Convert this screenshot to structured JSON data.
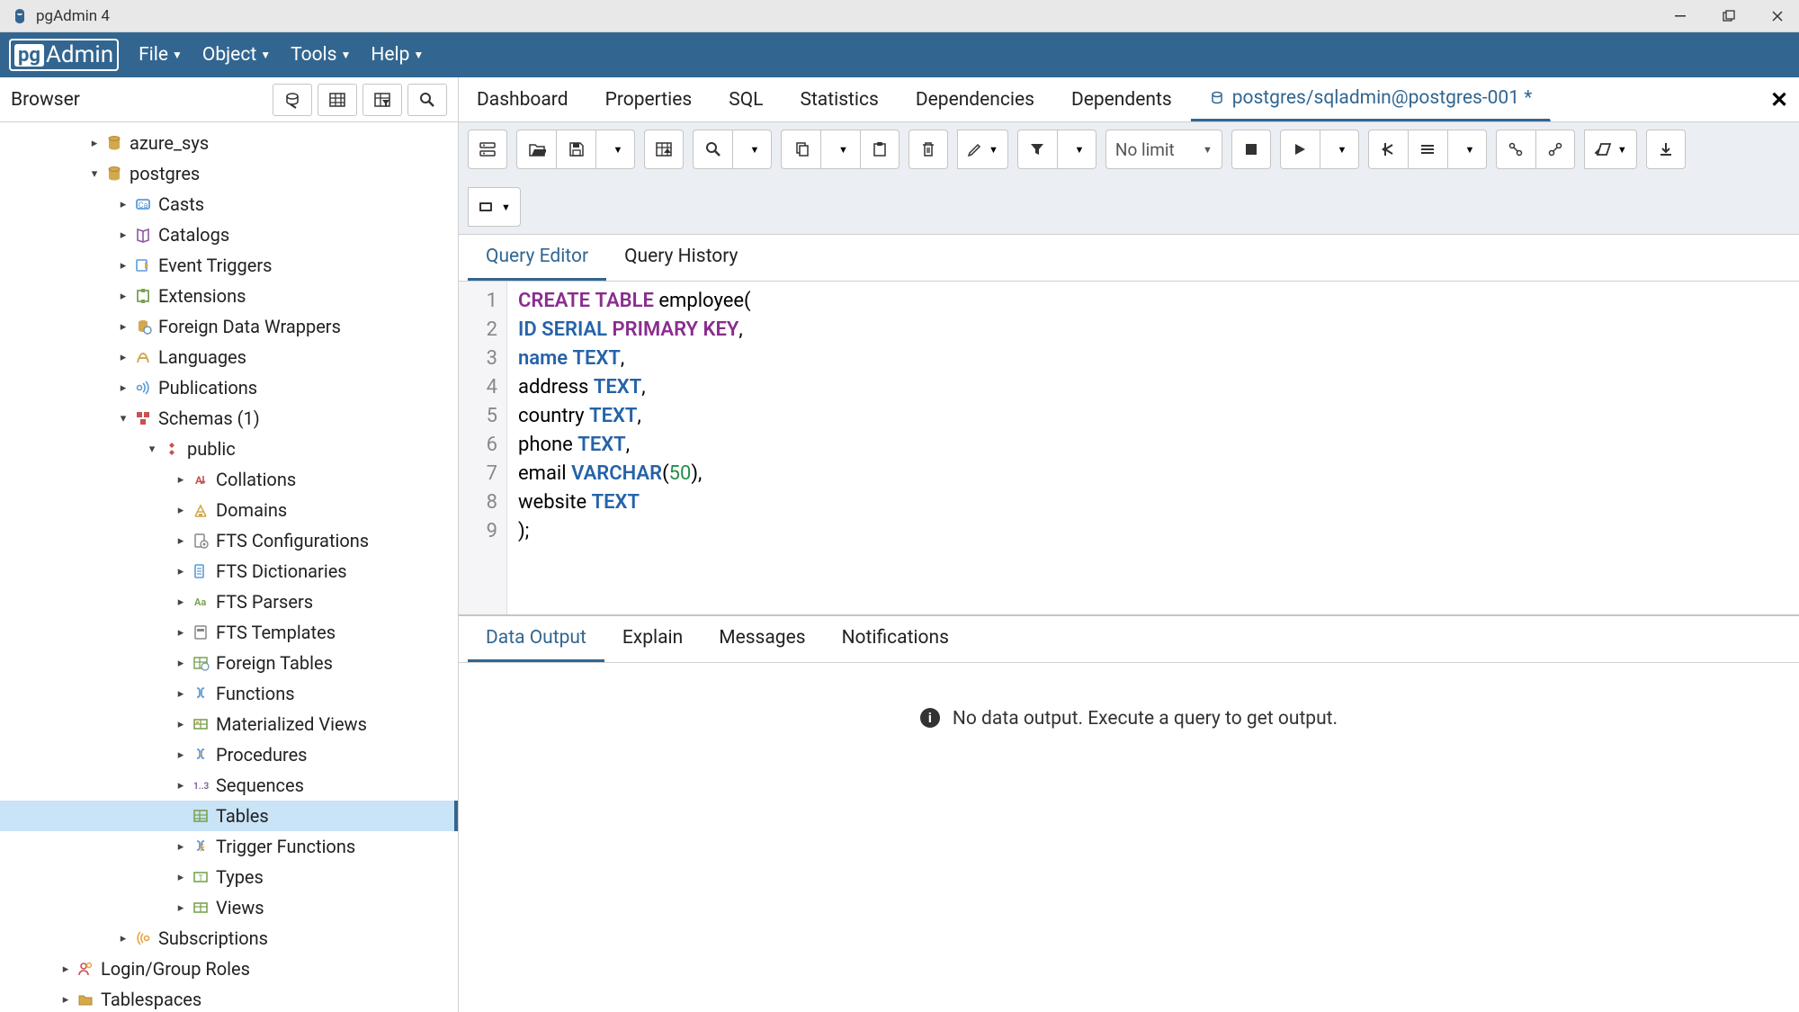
{
  "window": {
    "title": "pgAdmin 4"
  },
  "menubar": {
    "items": [
      "File",
      "Object",
      "Tools",
      "Help"
    ]
  },
  "browser_header": {
    "label": "Browser"
  },
  "main_tabs": [
    "Dashboard",
    "Properties",
    "SQL",
    "Statistics",
    "Dependencies",
    "Dependents"
  ],
  "active_tab_label": "postgres/sqladmin@postgres-001 *",
  "tree": [
    {
      "depth": 3,
      "chev": ">",
      "icon": "db-sys",
      "label": "azure_sys"
    },
    {
      "depth": 3,
      "chev": "v",
      "icon": "db",
      "label": "postgres"
    },
    {
      "depth": 4,
      "chev": ">",
      "icon": "casts",
      "label": "Casts"
    },
    {
      "depth": 4,
      "chev": ">",
      "icon": "catalogs",
      "label": "Catalogs"
    },
    {
      "depth": 4,
      "chev": ">",
      "icon": "event-trig",
      "label": "Event Triggers"
    },
    {
      "depth": 4,
      "chev": ">",
      "icon": "ext",
      "label": "Extensions"
    },
    {
      "depth": 4,
      "chev": ">",
      "icon": "fdw",
      "label": "Foreign Data Wrappers"
    },
    {
      "depth": 4,
      "chev": ">",
      "icon": "lang",
      "label": "Languages"
    },
    {
      "depth": 4,
      "chev": ">",
      "icon": "pub",
      "label": "Publications"
    },
    {
      "depth": 4,
      "chev": "v",
      "icon": "schema",
      "label": "Schemas (1)"
    },
    {
      "depth": 5,
      "chev": "v",
      "icon": "public",
      "label": "public"
    },
    {
      "depth": 6,
      "chev": ">",
      "icon": "coll",
      "label": "Collations"
    },
    {
      "depth": 6,
      "chev": ">",
      "icon": "domain",
      "label": "Domains"
    },
    {
      "depth": 6,
      "chev": ">",
      "icon": "ftsconf",
      "label": "FTS Configurations"
    },
    {
      "depth": 6,
      "chev": ">",
      "icon": "ftsdict",
      "label": "FTS Dictionaries"
    },
    {
      "depth": 6,
      "chev": ">",
      "icon": "ftspars",
      "label": "FTS Parsers"
    },
    {
      "depth": 6,
      "chev": ">",
      "icon": "ftstmpl",
      "label": "FTS Templates"
    },
    {
      "depth": 6,
      "chev": ">",
      "icon": "ftab",
      "label": "Foreign Tables"
    },
    {
      "depth": 6,
      "chev": ">",
      "icon": "func",
      "label": "Functions"
    },
    {
      "depth": 6,
      "chev": ">",
      "icon": "mview",
      "label": "Materialized Views"
    },
    {
      "depth": 6,
      "chev": ">",
      "icon": "proc",
      "label": "Procedures"
    },
    {
      "depth": 6,
      "chev": ">",
      "icon": "seq",
      "label": "Sequences"
    },
    {
      "depth": 6,
      "chev": "",
      "icon": "table",
      "label": "Tables",
      "selected": true
    },
    {
      "depth": 6,
      "chev": ">",
      "icon": "trigfunc",
      "label": "Trigger Functions"
    },
    {
      "depth": 6,
      "chev": ">",
      "icon": "type",
      "label": "Types"
    },
    {
      "depth": 6,
      "chev": ">",
      "icon": "view",
      "label": "Views"
    },
    {
      "depth": 4,
      "chev": ">",
      "icon": "sub",
      "label": "Subscriptions"
    },
    {
      "depth": 2,
      "chev": ">",
      "icon": "roles",
      "label": "Login/Group Roles"
    },
    {
      "depth": 2,
      "chev": ">",
      "icon": "tspace",
      "label": "Tablespaces"
    }
  ],
  "toolbar": {
    "limit_label": "No limit"
  },
  "editor_tabs": [
    "Query Editor",
    "Query History"
  ],
  "code_lines": [
    {
      "n": 1,
      "tokens": [
        {
          "t": "CREATE",
          "c": "kw"
        },
        {
          "t": " "
        },
        {
          "t": "TABLE",
          "c": "kw"
        },
        {
          "t": " employee("
        }
      ]
    },
    {
      "n": 2,
      "tokens": [
        {
          "t": "ID",
          "c": "id"
        },
        {
          "t": " "
        },
        {
          "t": "SERIAL",
          "c": "ty"
        },
        {
          "t": " "
        },
        {
          "t": "PRIMARY",
          "c": "kw"
        },
        {
          "t": " "
        },
        {
          "t": "KEY",
          "c": "kw"
        },
        {
          "t": ","
        }
      ]
    },
    {
      "n": 3,
      "tokens": [
        {
          "t": "name",
          "c": "id"
        },
        {
          "t": " "
        },
        {
          "t": "TEXT",
          "c": "ty"
        },
        {
          "t": ","
        }
      ]
    },
    {
      "n": 4,
      "tokens": [
        {
          "t": "address "
        },
        {
          "t": "TEXT",
          "c": "ty"
        },
        {
          "t": ","
        }
      ]
    },
    {
      "n": 5,
      "tokens": [
        {
          "t": "country "
        },
        {
          "t": "TEXT",
          "c": "ty"
        },
        {
          "t": ","
        }
      ]
    },
    {
      "n": 6,
      "tokens": [
        {
          "t": "phone "
        },
        {
          "t": "TEXT",
          "c": "ty"
        },
        {
          "t": ","
        }
      ]
    },
    {
      "n": 7,
      "tokens": [
        {
          "t": "email "
        },
        {
          "t": "VARCHAR",
          "c": "ty"
        },
        {
          "t": "("
        },
        {
          "t": "50",
          "c": "num"
        },
        {
          "t": "),"
        }
      ]
    },
    {
      "n": 8,
      "tokens": [
        {
          "t": "website "
        },
        {
          "t": "TEXT",
          "c": "ty"
        }
      ]
    },
    {
      "n": 9,
      "tokens": [
        {
          "t": ");"
        }
      ]
    }
  ],
  "output_tabs": [
    "Data Output",
    "Explain",
    "Messages",
    "Notifications"
  ],
  "output_message": "No data output. Execute a query to get output."
}
